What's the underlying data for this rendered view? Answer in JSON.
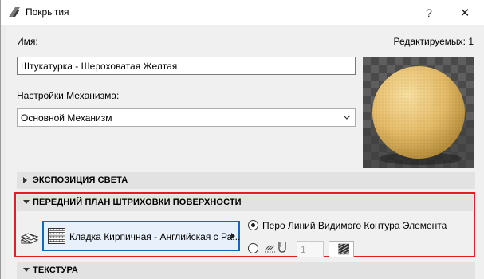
{
  "window": {
    "title": "Покрытия",
    "help_label": "?",
    "close_label": "✕"
  },
  "form": {
    "name_label": "Имя:",
    "editable_label": "Редактируемых: 1",
    "name_value": "Штукатурка - Шероховатая Желтая",
    "engine_label": "Настройки Механизма:",
    "engine_value": "Основной Механизм"
  },
  "sections": {
    "light_exposure": "ЭКСПОЗИЦИЯ СВЕТА",
    "surface_hatch": "ПЕРЕДНИЙ ПЛАН ШТРИХОВКИ ПОВЕРХНОСТИ",
    "texture": "ТЕКСТУРА"
  },
  "hatch": {
    "fill_name": "Кладка Кирпичная - Английская с Ра...",
    "pen_option_label": "Перо Линий Видимого Контура Элемента",
    "pen_number": "1"
  },
  "colors": {
    "highlight_border": "#e02020",
    "selected_border": "#0b6cc2",
    "sphere": "#e0b766"
  }
}
